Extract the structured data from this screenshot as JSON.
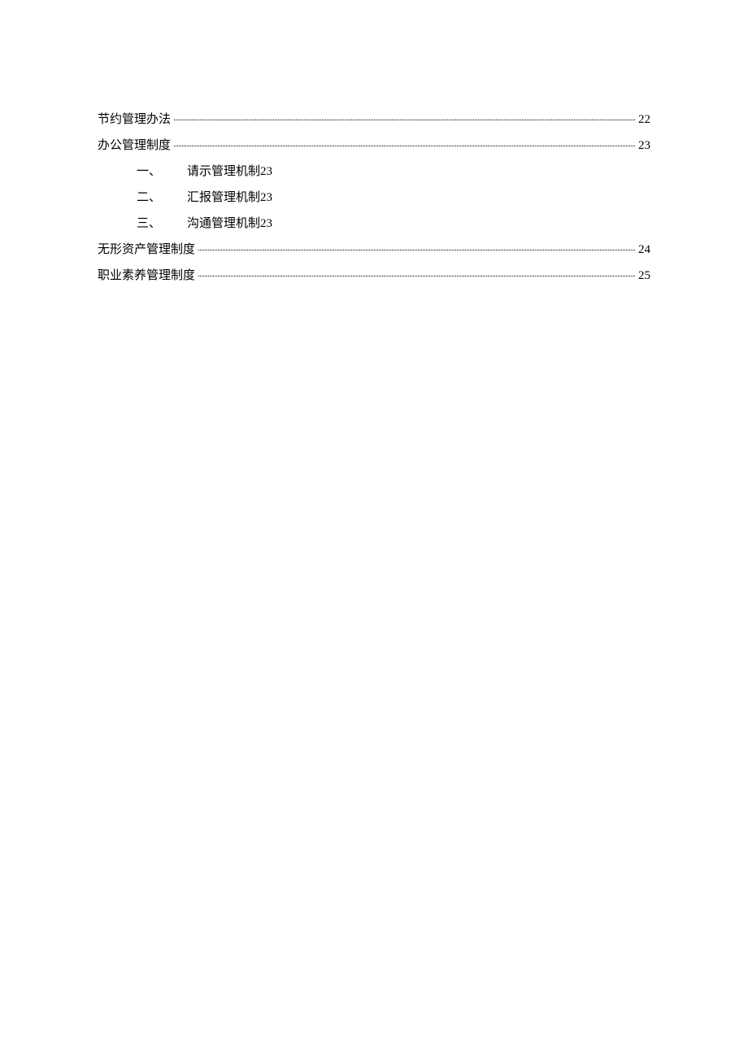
{
  "toc": {
    "entries": [
      {
        "title": "节约管理办法",
        "page": "22",
        "sub": []
      },
      {
        "title": "办公管理制度",
        "page": "23",
        "sub": [
          {
            "number": "一、",
            "title": "请示管理机制",
            "page": "23"
          },
          {
            "number": "二、",
            "title": "汇报管理机制",
            "page": "23"
          },
          {
            "number": "三、",
            "title": "沟通管理机制",
            "page": "23"
          }
        ]
      },
      {
        "title": "无形资产管理制度",
        "page": "24",
        "sub": []
      },
      {
        "title": "职业素养管理制度",
        "page": "25",
        "sub": []
      }
    ]
  }
}
